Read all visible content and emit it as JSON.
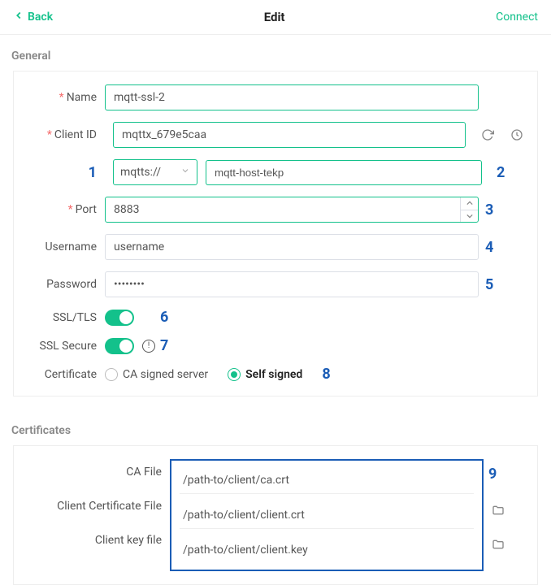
{
  "topbar": {
    "back": "Back",
    "title": "Edit",
    "connect": "Connect"
  },
  "sections": {
    "general": "General",
    "certificates": "Certificates"
  },
  "labels": {
    "name": "Name",
    "client_id": "Client ID",
    "port": "Port",
    "username": "Username",
    "password": "Password",
    "ssl_tls": "SSL/TLS",
    "ssl_secure": "SSL Secure",
    "certificate": "Certificate",
    "ca_file": "CA File",
    "client_cert_file": "Client Certificate File",
    "client_key_file": "Client key file"
  },
  "values": {
    "name": "mqtt-ssl-2",
    "client_id": "mqttx_679e5caa",
    "scheme": "mqtts://",
    "host": "mqtt-host-tekp",
    "port": "8883",
    "username": "username",
    "password": "••••••••",
    "ca_file": "/path-to/client/ca.crt",
    "client_cert_file": "/path-to/client/client.crt",
    "client_key_file": "/path-to/client/client.key"
  },
  "radio": {
    "ca_signed": "CA signed server",
    "self_signed": "Self signed"
  },
  "markers": {
    "m1": "1",
    "m2": "2",
    "m3": "3",
    "m4": "4",
    "m5": "5",
    "m6": "6",
    "m7": "7",
    "m8": "8",
    "m9": "9"
  }
}
